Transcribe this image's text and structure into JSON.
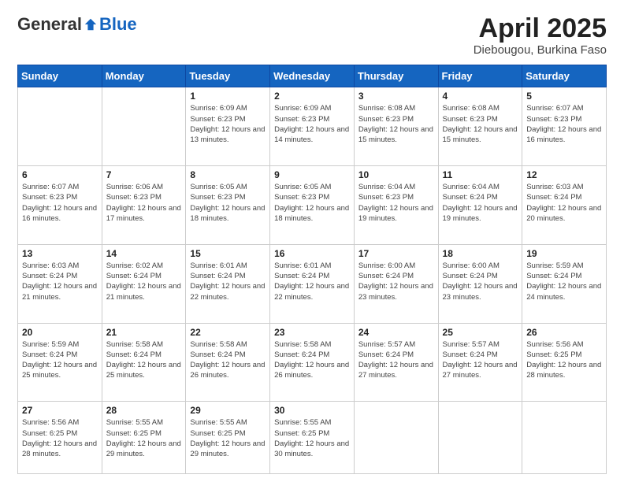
{
  "logo": {
    "general": "General",
    "blue": "Blue"
  },
  "title": "April 2025",
  "location": "Diebougou, Burkina Faso",
  "days_of_week": [
    "Sunday",
    "Monday",
    "Tuesday",
    "Wednesday",
    "Thursday",
    "Friday",
    "Saturday"
  ],
  "weeks": [
    [
      {
        "day": "",
        "info": ""
      },
      {
        "day": "",
        "info": ""
      },
      {
        "day": "1",
        "info": "Sunrise: 6:09 AM\nSunset: 6:23 PM\nDaylight: 12 hours and 13 minutes."
      },
      {
        "day": "2",
        "info": "Sunrise: 6:09 AM\nSunset: 6:23 PM\nDaylight: 12 hours and 14 minutes."
      },
      {
        "day": "3",
        "info": "Sunrise: 6:08 AM\nSunset: 6:23 PM\nDaylight: 12 hours and 15 minutes."
      },
      {
        "day": "4",
        "info": "Sunrise: 6:08 AM\nSunset: 6:23 PM\nDaylight: 12 hours and 15 minutes."
      },
      {
        "day": "5",
        "info": "Sunrise: 6:07 AM\nSunset: 6:23 PM\nDaylight: 12 hours and 16 minutes."
      }
    ],
    [
      {
        "day": "6",
        "info": "Sunrise: 6:07 AM\nSunset: 6:23 PM\nDaylight: 12 hours and 16 minutes."
      },
      {
        "day": "7",
        "info": "Sunrise: 6:06 AM\nSunset: 6:23 PM\nDaylight: 12 hours and 17 minutes."
      },
      {
        "day": "8",
        "info": "Sunrise: 6:05 AM\nSunset: 6:23 PM\nDaylight: 12 hours and 18 minutes."
      },
      {
        "day": "9",
        "info": "Sunrise: 6:05 AM\nSunset: 6:23 PM\nDaylight: 12 hours and 18 minutes."
      },
      {
        "day": "10",
        "info": "Sunrise: 6:04 AM\nSunset: 6:23 PM\nDaylight: 12 hours and 19 minutes."
      },
      {
        "day": "11",
        "info": "Sunrise: 6:04 AM\nSunset: 6:24 PM\nDaylight: 12 hours and 19 minutes."
      },
      {
        "day": "12",
        "info": "Sunrise: 6:03 AM\nSunset: 6:24 PM\nDaylight: 12 hours and 20 minutes."
      }
    ],
    [
      {
        "day": "13",
        "info": "Sunrise: 6:03 AM\nSunset: 6:24 PM\nDaylight: 12 hours and 21 minutes."
      },
      {
        "day": "14",
        "info": "Sunrise: 6:02 AM\nSunset: 6:24 PM\nDaylight: 12 hours and 21 minutes."
      },
      {
        "day": "15",
        "info": "Sunrise: 6:01 AM\nSunset: 6:24 PM\nDaylight: 12 hours and 22 minutes."
      },
      {
        "day": "16",
        "info": "Sunrise: 6:01 AM\nSunset: 6:24 PM\nDaylight: 12 hours and 22 minutes."
      },
      {
        "day": "17",
        "info": "Sunrise: 6:00 AM\nSunset: 6:24 PM\nDaylight: 12 hours and 23 minutes."
      },
      {
        "day": "18",
        "info": "Sunrise: 6:00 AM\nSunset: 6:24 PM\nDaylight: 12 hours and 23 minutes."
      },
      {
        "day": "19",
        "info": "Sunrise: 5:59 AM\nSunset: 6:24 PM\nDaylight: 12 hours and 24 minutes."
      }
    ],
    [
      {
        "day": "20",
        "info": "Sunrise: 5:59 AM\nSunset: 6:24 PM\nDaylight: 12 hours and 25 minutes."
      },
      {
        "day": "21",
        "info": "Sunrise: 5:58 AM\nSunset: 6:24 PM\nDaylight: 12 hours and 25 minutes."
      },
      {
        "day": "22",
        "info": "Sunrise: 5:58 AM\nSunset: 6:24 PM\nDaylight: 12 hours and 26 minutes."
      },
      {
        "day": "23",
        "info": "Sunrise: 5:58 AM\nSunset: 6:24 PM\nDaylight: 12 hours and 26 minutes."
      },
      {
        "day": "24",
        "info": "Sunrise: 5:57 AM\nSunset: 6:24 PM\nDaylight: 12 hours and 27 minutes."
      },
      {
        "day": "25",
        "info": "Sunrise: 5:57 AM\nSunset: 6:24 PM\nDaylight: 12 hours and 27 minutes."
      },
      {
        "day": "26",
        "info": "Sunrise: 5:56 AM\nSunset: 6:25 PM\nDaylight: 12 hours and 28 minutes."
      }
    ],
    [
      {
        "day": "27",
        "info": "Sunrise: 5:56 AM\nSunset: 6:25 PM\nDaylight: 12 hours and 28 minutes."
      },
      {
        "day": "28",
        "info": "Sunrise: 5:55 AM\nSunset: 6:25 PM\nDaylight: 12 hours and 29 minutes."
      },
      {
        "day": "29",
        "info": "Sunrise: 5:55 AM\nSunset: 6:25 PM\nDaylight: 12 hours and 29 minutes."
      },
      {
        "day": "30",
        "info": "Sunrise: 5:55 AM\nSunset: 6:25 PM\nDaylight: 12 hours and 30 minutes."
      },
      {
        "day": "",
        "info": ""
      },
      {
        "day": "",
        "info": ""
      },
      {
        "day": "",
        "info": ""
      }
    ]
  ]
}
